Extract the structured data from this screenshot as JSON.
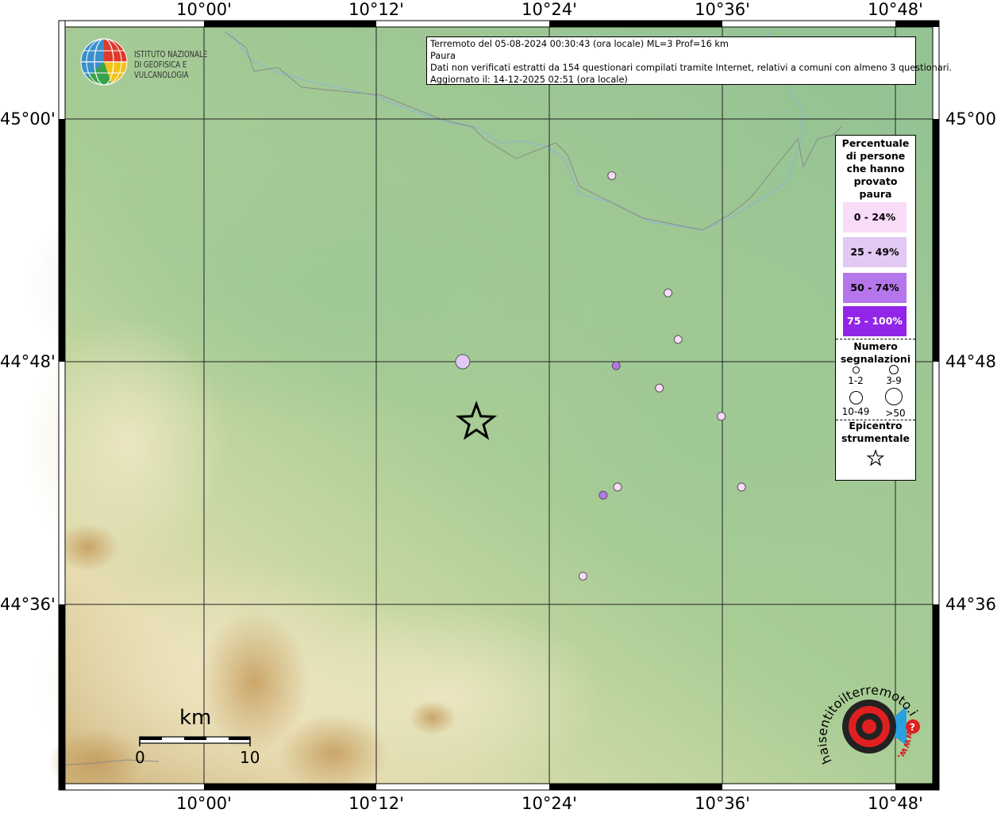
{
  "map": {
    "longitude_labels": [
      "10°00'",
      "10°12'",
      "10°24'",
      "10°36'",
      "10°48'"
    ],
    "latitude_labels": [
      "45°00'",
      "44°48'",
      "44°36'"
    ]
  },
  "info_box": {
    "line1": "Terremoto del 05-08-2024 00:30:43 (ora locale) ML=3 Prof=16 km",
    "line2": "Paura",
    "line3": "Dati non verificati estratti da 154 questionari compilati tramite Internet, relativi a comuni con almeno 3 questionari.",
    "line4": "Aggiornato il: 14-12-2025 02:51 (ora locale)"
  },
  "logo": {
    "line1": "ISTITUTO NAZIONALE",
    "line2": "DI GEOFISICA E VULCANOLOGIA"
  },
  "legend": {
    "title_lines": [
      "Percentuale",
      "di persone",
      "che hanno",
      "provato",
      "paura"
    ],
    "classes": [
      {
        "label": "0 - 24%",
        "color": "#f8dcf8",
        "text_color": "#000000"
      },
      {
        "label": "25 - 49%",
        "color": "#e2c8f4",
        "text_color": "#000000"
      },
      {
        "label": "50 - 74%",
        "color": "#b476ea",
        "text_color": "#000000"
      },
      {
        "label": "75 - 100%",
        "color": "#9225e8",
        "text_color": "#ffffff"
      }
    ],
    "count_title_lines": [
      "Numero",
      "segnalazioni"
    ],
    "count_labels": [
      "1-2",
      "3-9",
      "10-49",
      ">50"
    ],
    "epicenter_title_lines": [
      "Epicentro",
      "strumentale"
    ]
  },
  "scale_bar": {
    "unit": "km",
    "start": "0",
    "end": "10"
  },
  "watermark": {
    "text": "haisentitoilterremoto.it",
    "url_prefix": "www."
  },
  "epicenter": {
    "lon": 10.315,
    "lat": 44.75
  },
  "points": [
    {
      "lon": 10.4717,
      "lat": 44.9533,
      "class": 0,
      "size": "3-9"
    },
    {
      "lon": 10.2992,
      "lat": 44.8,
      "class": 1,
      "size": "10-49"
    },
    {
      "lon": 10.4767,
      "lat": 44.7967,
      "class": 2,
      "size": "3-9"
    },
    {
      "lon": 10.5367,
      "lat": 44.8567,
      "class": 0,
      "size": "3-9"
    },
    {
      "lon": 10.5483,
      "lat": 44.8183,
      "class": 0,
      "size": "3-9"
    },
    {
      "lon": 10.5267,
      "lat": 44.7783,
      "class": 0,
      "size": "3-9"
    },
    {
      "lon": 10.5983,
      "lat": 44.755,
      "class": 0,
      "size": "3-9"
    },
    {
      "lon": 10.6217,
      "lat": 44.6967,
      "class": 0,
      "size": "3-9"
    },
    {
      "lon": 10.4783,
      "lat": 44.6967,
      "class": 0,
      "size": "3-9"
    },
    {
      "lon": 10.4617,
      "lat": 44.69,
      "class": 2,
      "size": "3-9"
    },
    {
      "lon": 10.4383,
      "lat": 44.6233,
      "class": 0,
      "size": "3-9"
    }
  ]
}
